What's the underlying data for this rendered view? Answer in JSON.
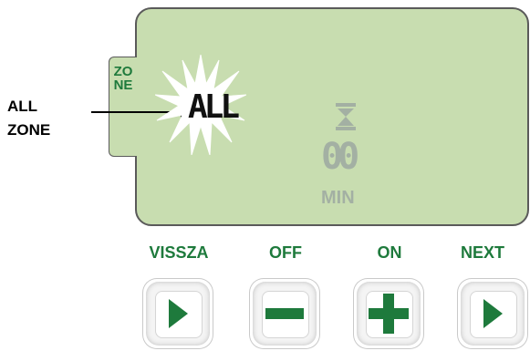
{
  "callout": {
    "line1": "ALL",
    "line2": "ZONE"
  },
  "zone_tab": {
    "letters": "ZONE"
  },
  "display": {
    "zone_text": "ALL",
    "timer_digits": "00",
    "timer_unit": "MIN"
  },
  "buttons": [
    {
      "label": "VISSZA",
      "icon": "play-icon"
    },
    {
      "label": "OFF",
      "icon": "minus-icon"
    },
    {
      "label": "ON",
      "icon": "plus-icon"
    },
    {
      "label": "NEXT",
      "icon": "play-icon"
    }
  ],
  "colors": {
    "lcd": "#c8ddb0",
    "accent": "#1e7a3c",
    "dim_segment": "#a3b0a3"
  }
}
